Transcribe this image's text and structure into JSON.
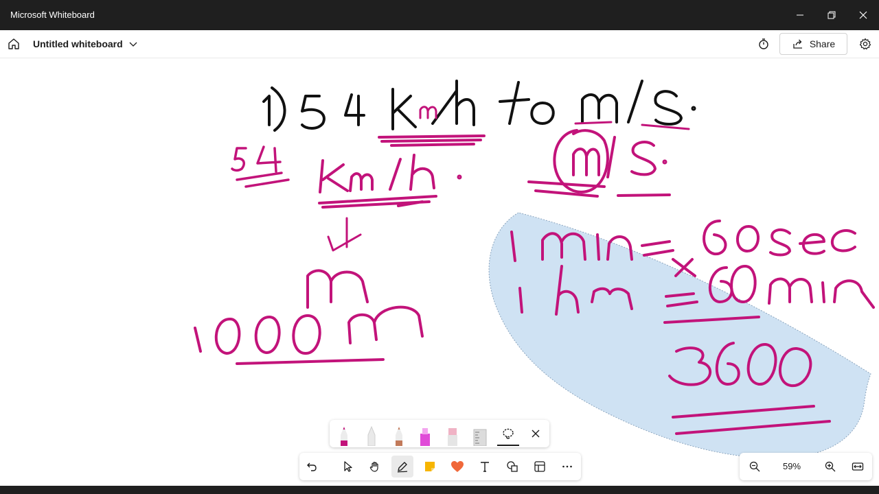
{
  "window": {
    "app_title": "Microsoft Whiteboard"
  },
  "header": {
    "board_title": "Untitled whiteboard",
    "share_label": "Share"
  },
  "zoom": {
    "level_text": "59%"
  },
  "colors": {
    "ink_black": "#111111",
    "ink_magenta": "#c2137a",
    "lasso_fill": "#cfe2f3",
    "titlebar": "#1f1f1f"
  },
  "board": {
    "line1": "1) 54 Km/h to m/s.",
    "small_54": "54",
    "kmh": "Km/h",
    "ms": "m/s.",
    "m": "m",
    "thousand_m": "1000m",
    "eq1": "1 min = 60 sec",
    "eq2": "1 hr = 60 min",
    "result": "3600"
  },
  "icons": {
    "home": "home-icon",
    "chevron": "chevron-down-icon",
    "timer": "timer-icon",
    "share": "share-icon",
    "settings": "gear-icon",
    "undo": "undo-icon",
    "select": "pointer-icon",
    "hand": "hand-icon",
    "pen": "pen-icon",
    "note": "sticky-note-icon",
    "reaction": "heart-icon",
    "text": "text-icon",
    "shapes": "shapes-icon",
    "template": "template-icon",
    "more": "more-icon",
    "zoom_out": "zoom-out-icon",
    "zoom_in": "zoom-in-icon",
    "fit": "fit-to-screen-icon",
    "lasso": "lasso-icon",
    "close": "close-icon"
  }
}
